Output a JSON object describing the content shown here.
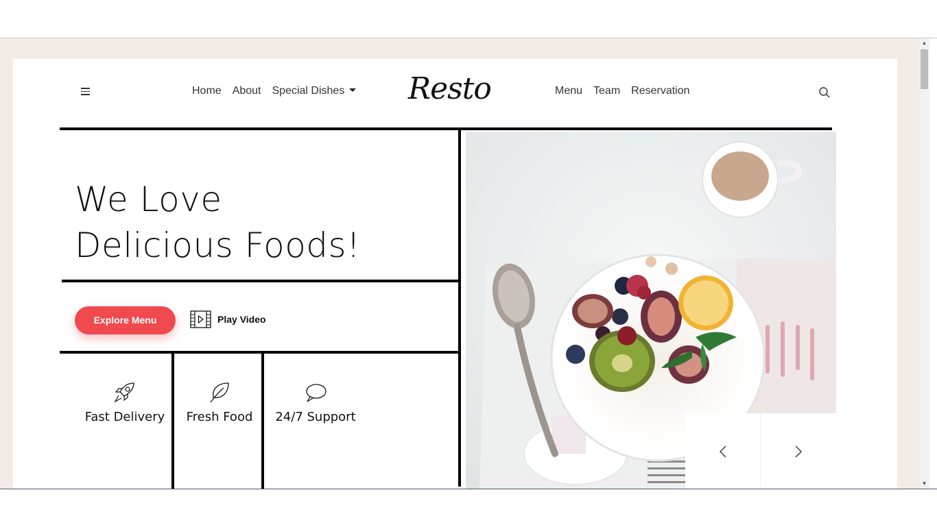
{
  "header": {
    "logo_text": "Resto",
    "nav_left": [
      "Home",
      "About",
      "Special Dishes"
    ],
    "nav_right": [
      "Menu",
      "Team",
      "Reservation"
    ]
  },
  "hero": {
    "headline_line1": "We Love",
    "headline_line2": "Delicious Foods!",
    "explore_button": "Explore Menu",
    "play_video": "Play Video"
  },
  "features": [
    {
      "label": "Fast Delivery",
      "icon": "rocket-icon"
    },
    {
      "label": "Fresh Food",
      "icon": "leaf-icon"
    },
    {
      "label": "24/7 Support",
      "icon": "chat-bubble-icon"
    }
  ],
  "slider": {
    "prev_icon": "chevron-left-icon",
    "next_icon": "chevron-right-icon"
  },
  "colors": {
    "accent": "#f0494e",
    "page_background": "#f3ece6",
    "card_background": "#ffffff",
    "text": "#111111"
  }
}
